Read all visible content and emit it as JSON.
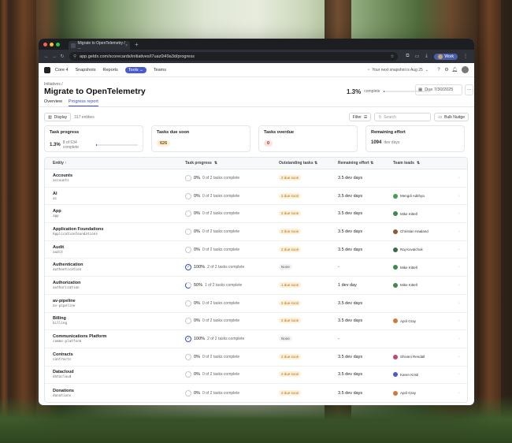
{
  "browser": {
    "tab_title": "Migrate to OpenTelemetry / ...",
    "url": "app.getdx.com/scorecards/initiatives/l7uaz0i49a3d/progress",
    "profile_label": "Work"
  },
  "app": {
    "nav": [
      "Core 4",
      "Snapshots",
      "Reports",
      "Tools",
      "Teams"
    ],
    "snapshot_text": "Your next snapshot is Aug 25"
  },
  "page": {
    "breadcrumb": "Initiatives /",
    "title": "Migrate to OpenTelemetry",
    "completion_value": "1.3%",
    "completion_suffix": "complete",
    "completion_fraction": 0.013,
    "due_date": "Due 7/30/2025",
    "tabs": [
      "Overview",
      "Progress report"
    ]
  },
  "toolbar": {
    "display_label": "Display",
    "entity_count": "317 entities",
    "filter_label": "Filter",
    "search_placeholder": "Search",
    "nudge_label": "Bulk Nudge"
  },
  "cards": [
    {
      "title": "Task progress",
      "value": "1.3%",
      "sub": "8 of 634 complete"
    },
    {
      "title": "Tasks due soon",
      "value": "626"
    },
    {
      "title": "Tasks overdue",
      "value": "0"
    },
    {
      "title": "Remaining effort",
      "value": "1094",
      "sub": "dev days"
    }
  ],
  "table": {
    "headers": [
      "Entity",
      "Task progress",
      "Outstanding tasks",
      "Remaining effort",
      "Team leads"
    ],
    "rows": [
      {
        "name": "Accounts",
        "code": "accounts",
        "pct": "0%",
        "tasks": "0 of 2 tasks complete",
        "status": "2 due soon",
        "effort": "3.5 dev days",
        "lead": "",
        "state": "empty"
      },
      {
        "name": "AI",
        "code": "ai",
        "pct": "0%",
        "tasks": "0 of 2 tasks complete",
        "status": "2 due soon",
        "effort": "3.5 dev days",
        "lead": "Mengdi Adithya",
        "lead_color": "#4a9a5a",
        "state": "empty"
      },
      {
        "name": "App",
        "code": "app",
        "pct": "0%",
        "tasks": "0 of 2 tasks complete",
        "status": "2 due soon",
        "effort": "3.5 dev days",
        "lead": "Mike Kittell",
        "lead_color": "#3f8a4a",
        "state": "empty"
      },
      {
        "name": "Application Foundations",
        "code": "ApplicationFoundations",
        "pct": "0%",
        "tasks": "0 of 2 tasks complete",
        "status": "2 due soon",
        "effort": "3.5 dev days",
        "lead": "Christian Haaland",
        "lead_color": "#8a5a3a",
        "state": "empty"
      },
      {
        "name": "Audit",
        "code": "audit",
        "pct": "0%",
        "tasks": "0 of 2 tasks complete",
        "status": "2 due soon",
        "effort": "3.5 dev days",
        "lead": "Raj Kovalchuk",
        "lead_color": "#3a6a4a",
        "state": "empty"
      },
      {
        "name": "Authentication",
        "code": "authentication",
        "pct": "100%",
        "tasks": "2 of 2 tasks complete",
        "status": "None",
        "effort": "-",
        "lead": "Mike Kittell",
        "lead_color": "#3f8a4a",
        "state": "done"
      },
      {
        "name": "Authorization",
        "code": "authorization",
        "pct": "50%",
        "tasks": "1 of 2 tasks complete",
        "status": "1 due soon",
        "effort": "1 dev day",
        "lead": "Mike Kittell",
        "lead_color": "#3f8a4a",
        "state": "half"
      },
      {
        "name": "av-pipeline",
        "code": "av-pipeline",
        "pct": "0%",
        "tasks": "0 of 2 tasks complete",
        "status": "2 due soon",
        "effort": "3.5 dev days",
        "lead": "",
        "state": "empty"
      },
      {
        "name": "Billing",
        "code": "billing",
        "pct": "0%",
        "tasks": "0 of 2 tasks complete",
        "status": "2 due soon",
        "effort": "3.5 dev days",
        "lead": "April Gray",
        "lead_color": "#d07a3a",
        "state": "empty"
      },
      {
        "name": "Communications Platform",
        "code": "comms-platform",
        "pct": "100%",
        "tasks": "2 of 2 tasks complete",
        "status": "None",
        "effort": "-",
        "lead": "",
        "state": "done"
      },
      {
        "name": "Contracts",
        "code": "contracts",
        "pct": "0%",
        "tasks": "0 of 2 tasks complete",
        "status": "2 due soon",
        "effort": "3.5 dev days",
        "lead": "Shivani Rendall",
        "lead_color": "#c04a6a",
        "state": "empty"
      },
      {
        "name": "Datacloud",
        "code": "datacloud",
        "pct": "0%",
        "tasks": "0 of 2 tasks complete",
        "status": "2 due soon",
        "effort": "3.5 dev days",
        "lead": "Karen Kristi",
        "lead_color": "#4a5ad0",
        "state": "empty"
      },
      {
        "name": "Donations",
        "code": "donations",
        "pct": "0%",
        "tasks": "0 of 2 tasks complete",
        "status": "2 due soon",
        "effort": "3.5 dev days",
        "lead": "April Gray",
        "lead_color": "#d07a3a",
        "state": "empty"
      }
    ]
  },
  "colors": {
    "accent": "#3a4ec0",
    "due_soon_bg": "#fdf0d8",
    "due_soon_fg": "#b0700f",
    "overdue_bg": "#fde3de"
  }
}
